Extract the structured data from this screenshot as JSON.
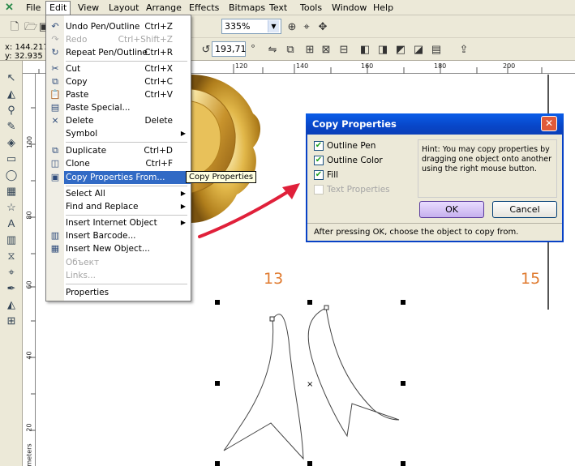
{
  "menubar": {
    "items": [
      "File",
      "Edit",
      "View",
      "Layout",
      "Arrange",
      "Effects",
      "Bitmaps",
      "Text",
      "Tools",
      "Window",
      "Help"
    ]
  },
  "toolbar": {
    "zoom": "335%",
    "rotation": "193,71",
    "degree_symbol": "°",
    "x_coord": "x: 144.217",
    "y_coord": "y: 32.935"
  },
  "ruler": {
    "h_ticks": [
      "120",
      "140",
      "160",
      "180",
      "200"
    ],
    "v_ticks": [
      "100",
      "80",
      "60",
      "40",
      "20"
    ],
    "v_unit": "meters"
  },
  "edit_menu": {
    "items": [
      {
        "label": "Undo Pen/Outline",
        "shortcut": "Ctrl+Z",
        "icon": "undo-icon"
      },
      {
        "label": "Redo",
        "shortcut": "Ctrl+Shift+Z",
        "icon": "redo-icon",
        "disabled": true
      },
      {
        "label": "Repeat Pen/Outline",
        "shortcut": "Ctrl+R",
        "icon": "repeat-icon"
      },
      {
        "label": "Cut",
        "shortcut": "Ctrl+X",
        "icon": "scissors-icon"
      },
      {
        "label": "Copy",
        "shortcut": "Ctrl+C",
        "icon": "copy-icon"
      },
      {
        "label": "Paste",
        "shortcut": "Ctrl+V",
        "icon": "paste-icon"
      },
      {
        "label": "Paste Special...",
        "shortcut": "",
        "icon": "paste-special-icon"
      },
      {
        "label": "Delete",
        "shortcut": "Delete",
        "icon": "delete-icon"
      },
      {
        "label": "Symbol",
        "shortcut": "",
        "submenu": true
      },
      {
        "label": "Duplicate",
        "shortcut": "Ctrl+D",
        "icon": "duplicate-icon"
      },
      {
        "label": "Clone",
        "shortcut": "Ctrl+F",
        "icon": "clone-icon"
      },
      {
        "label": "Copy Properties From...",
        "shortcut": "",
        "icon": "copy-properties-icon",
        "highlighted": true
      },
      {
        "label": "Select All",
        "shortcut": "",
        "submenu": true
      },
      {
        "label": "Find and Replace",
        "shortcut": "",
        "submenu": true
      },
      {
        "label": "Insert Internet Object",
        "shortcut": "",
        "submenu": true
      },
      {
        "label": "Insert Barcode...",
        "shortcut": "",
        "icon": "barcode-icon"
      },
      {
        "label": "Insert New Object...",
        "shortcut": "",
        "icon": "new-object-icon"
      },
      {
        "label": "Объект",
        "shortcut": "",
        "disabled": true
      },
      {
        "label": "Links...",
        "shortcut": "",
        "disabled": true
      },
      {
        "label": "Properties",
        "shortcut": ""
      }
    ]
  },
  "tooltip": "Copy Properties",
  "dialog": {
    "title": "Copy Properties",
    "close": "✕",
    "checkboxes": [
      {
        "label": "Outline Pen",
        "checked": true
      },
      {
        "label": "Outline Color",
        "checked": true
      },
      {
        "label": "Fill",
        "checked": true
      },
      {
        "label": "Text Properties",
        "checked": false,
        "disabled": true
      }
    ],
    "hint": "Hint: You may copy properties by dragging one object onto another using the right mouse button.",
    "ok": "OK",
    "cancel": "Cancel",
    "footer": "After pressing OK, choose the object to copy from."
  },
  "canvas": {
    "page_labels": [
      "13",
      "15"
    ]
  },
  "colors": {
    "accent": "#316ac5",
    "title_blue": "#0846c8",
    "page_number": "#e07b30",
    "arrow": "#e0203a"
  }
}
